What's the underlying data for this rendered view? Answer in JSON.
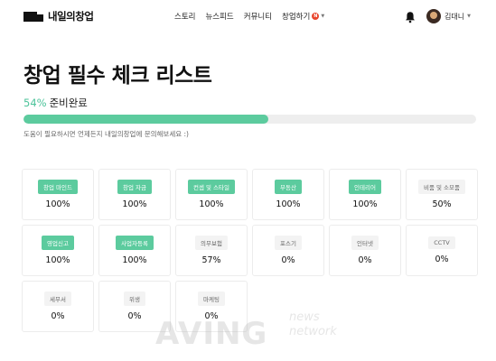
{
  "header": {
    "logo_text": "내일의창업",
    "nav": [
      {
        "label": "스토리"
      },
      {
        "label": "뉴스피드"
      },
      {
        "label": "커뮤니티"
      },
      {
        "label": "창업하기",
        "badge": "N"
      }
    ],
    "user_name": "김대니"
  },
  "page": {
    "title": "창업 필수 체크 리스트",
    "progress_percent_text": "54%",
    "progress_label": "준비완료",
    "progress_value": 54,
    "help_text": "도움이 필요하시면 언제든지 내일의창업에 문의해보세요 :)"
  },
  "checklist": [
    {
      "tag": "창업 마인드",
      "percent": "100%",
      "done": true
    },
    {
      "tag": "창업 자금",
      "percent": "100%",
      "done": true
    },
    {
      "tag": "컨셉 및 스타일",
      "percent": "100%",
      "done": true
    },
    {
      "tag": "부동산",
      "percent": "100%",
      "done": true
    },
    {
      "tag": "인테리어",
      "percent": "100%",
      "done": true
    },
    {
      "tag": "비품 및 소모품",
      "percent": "50%",
      "done": false
    },
    {
      "tag": "영업신고",
      "percent": "100%",
      "done": true
    },
    {
      "tag": "사업자등록",
      "percent": "100%",
      "done": true
    },
    {
      "tag": "의무보험",
      "percent": "57%",
      "done": false
    },
    {
      "tag": "포스기",
      "percent": "0%",
      "done": false
    },
    {
      "tag": "인터넷",
      "percent": "0%",
      "done": false
    },
    {
      "tag": "CCTV",
      "percent": "0%",
      "done": false
    },
    {
      "tag": "세무서",
      "percent": "0%",
      "done": false
    },
    {
      "tag": "위생",
      "percent": "0%",
      "done": false
    },
    {
      "tag": "마케팅",
      "percent": "0%",
      "done": false
    }
  ],
  "watermark": {
    "main": "AVING",
    "sub1": "news",
    "sub2": "network"
  },
  "colors": {
    "accent": "#5ccb9e",
    "accent_text": "#4cc39a",
    "badge": "#e8452c"
  }
}
